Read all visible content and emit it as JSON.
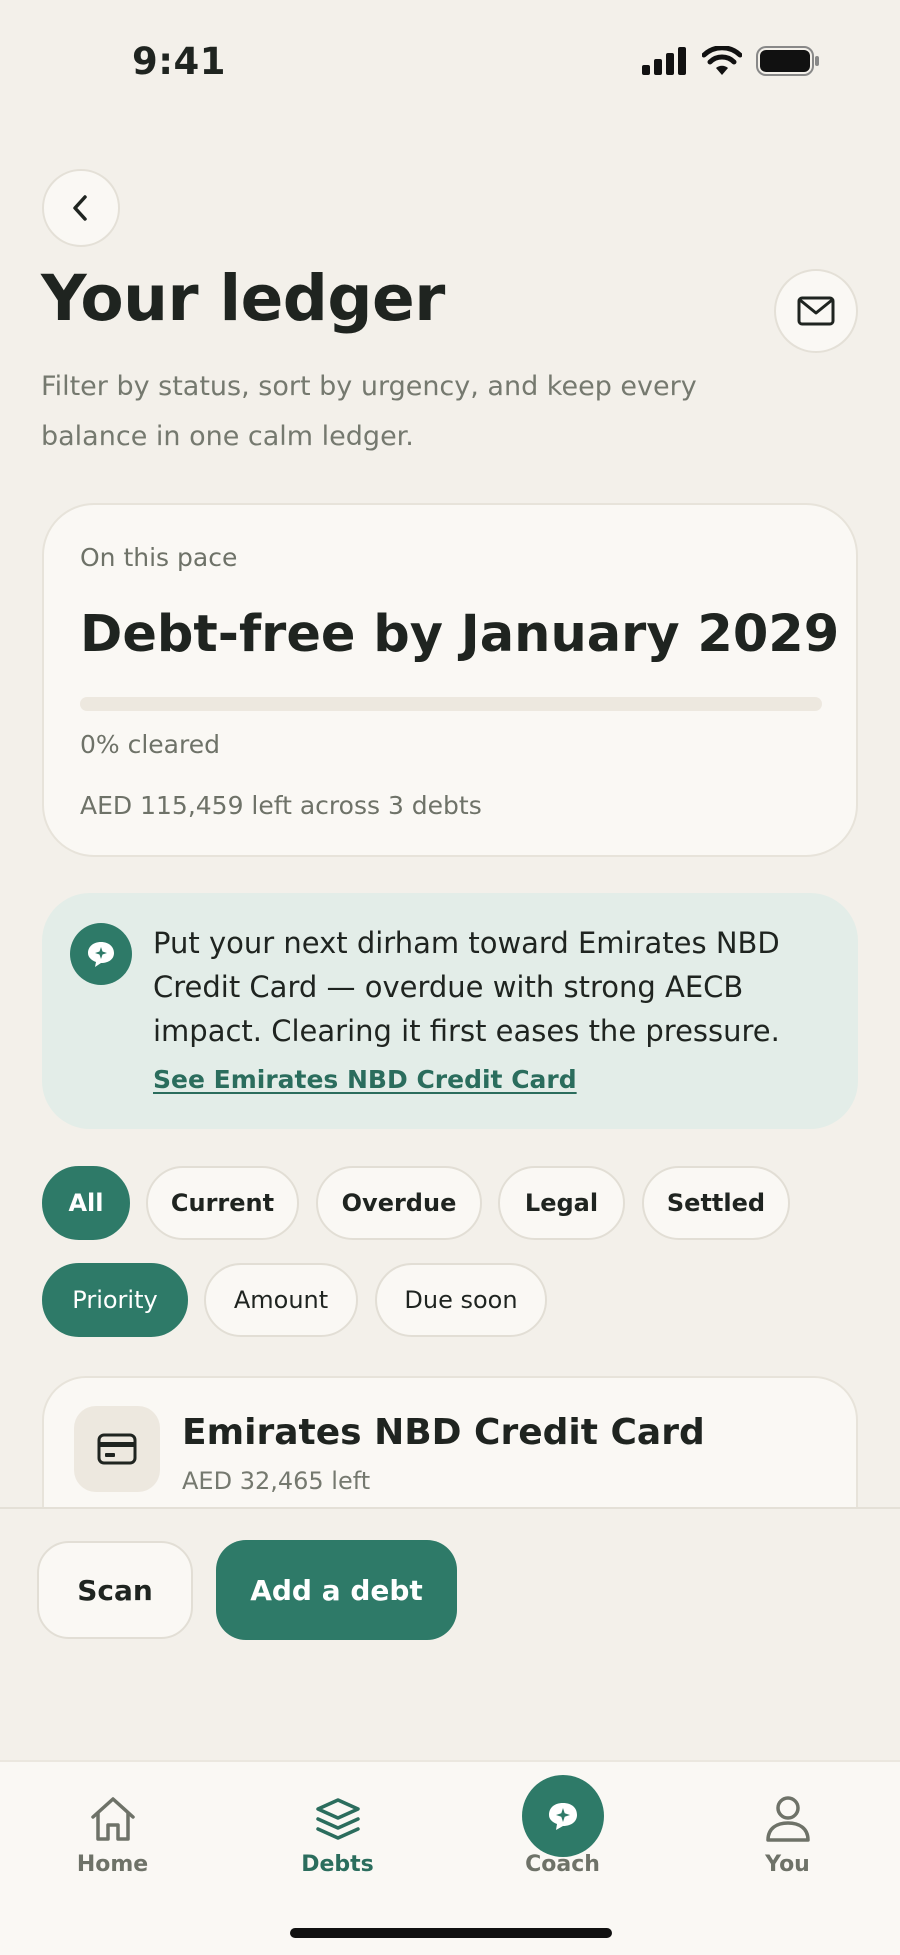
{
  "status_bar": {
    "time": "9:41"
  },
  "header": {
    "title": "Your ledger",
    "subtitle": "Filter by status, sort by urgency, and keep every balance in one calm ledger."
  },
  "pace_card": {
    "label": "On this pace",
    "headline": "Debt-free by January 2029",
    "progress_percent": 0,
    "cleared_text": "0% cleared",
    "left_text": "AED 115,459 left across 3 debts"
  },
  "coach_card": {
    "message": "Put your next dirham toward Emirates NBD Credit Card — overdue with strong AECB impact. Clearing it first eases the pressure.",
    "link_label": "See Emirates NBD Credit Card"
  },
  "filters": {
    "status": [
      "All",
      "Current",
      "Overdue",
      "Legal",
      "Settled"
    ],
    "active_status": "All",
    "sort": [
      "Priority",
      "Amount",
      "Due soon"
    ],
    "active_sort": "Priority"
  },
  "debts": [
    {
      "name": "Emirates NBD Credit Card",
      "left": "AED 32,465 left",
      "icon": "credit-card-icon"
    }
  ],
  "actions": {
    "scan_label": "Scan",
    "add_label": "Add a debt"
  },
  "tabs": [
    {
      "label": "Home",
      "icon": "home-icon",
      "active": false
    },
    {
      "label": "Debts",
      "icon": "layers-icon",
      "active": true
    },
    {
      "label": "Coach",
      "icon": "chat-icon",
      "active": false
    },
    {
      "label": "You",
      "icon": "user-icon",
      "active": false
    }
  ],
  "colors": {
    "background": "#f3f0ea",
    "accent": "#2e7a68",
    "card": "#faf8f4",
    "coach_card": "#e3ede8",
    "text": "#1f2420",
    "muted": "#6e7268"
  }
}
